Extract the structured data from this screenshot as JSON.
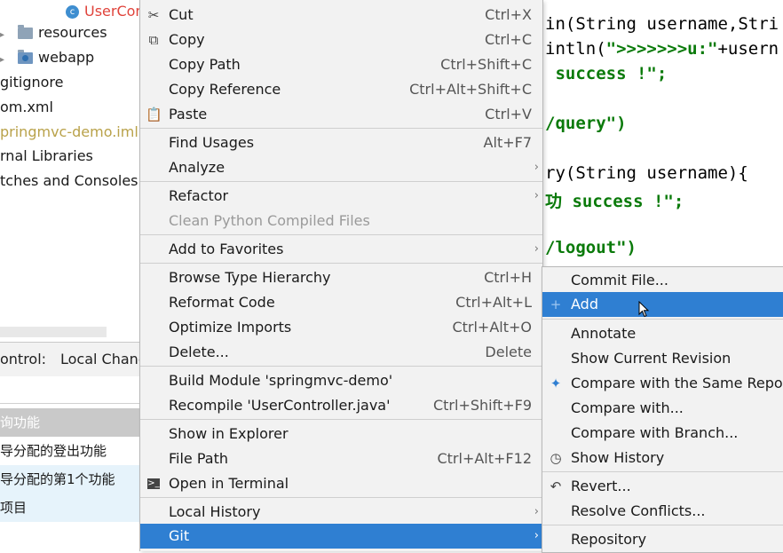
{
  "project_tree": {
    "selected_file": "UserCon",
    "items": [
      {
        "label": "resources",
        "icon": "folder-icon"
      },
      {
        "label": "webapp",
        "icon": "web-folder-icon"
      },
      {
        "label": "gitignore"
      },
      {
        "label": "om.xml"
      },
      {
        "label": "pringmvc-demo.iml"
      },
      {
        "label": "rnal Libraries"
      },
      {
        "label": "tches and Consoles"
      }
    ]
  },
  "version_control": {
    "label": "ontrol:",
    "tab": "Local Chang",
    "commits": [
      "询功能",
      "导分配的登出功能",
      "导分配的第1个功能",
      "项目"
    ]
  },
  "editor": {
    "lines": [
      {
        "text": "in(String username,Stri"
      },
      {
        "pre": "intln(",
        "str": "\">>>>>>>u:\"",
        "post": "+usern"
      },
      {
        "str": " success !\";"
      },
      {
        "ann": "/query\")"
      },
      {
        "text": "ry(String username){"
      },
      {
        "str": "功 success !\";"
      },
      {
        "ann": "/logout\")"
      }
    ]
  },
  "context_menu": {
    "items": [
      {
        "label": "Cut",
        "shortcut": "Ctrl+X",
        "icon": "scissors-icon"
      },
      {
        "label": "Copy",
        "shortcut": "Ctrl+C",
        "icon": "copy-icon"
      },
      {
        "label": "Copy Path",
        "shortcut": "Ctrl+Shift+C"
      },
      {
        "label": "Copy Reference",
        "shortcut": "Ctrl+Alt+Shift+C"
      },
      {
        "label": "Paste",
        "shortcut": "Ctrl+V",
        "icon": "clipboard-icon"
      },
      {
        "label": "Find Usages",
        "shortcut": "Alt+F7"
      },
      {
        "label": "Analyze",
        "submenu": true
      },
      {
        "label": "Refactor",
        "submenu": true
      },
      {
        "label": "Clean Python Compiled Files",
        "disabled": true
      },
      {
        "label": "Add to Favorites",
        "submenu": true
      },
      {
        "label": "Browse Type Hierarchy",
        "shortcut": "Ctrl+H"
      },
      {
        "label": "Reformat Code",
        "shortcut": "Ctrl+Alt+L"
      },
      {
        "label": "Optimize Imports",
        "shortcut": "Ctrl+Alt+O"
      },
      {
        "label": "Delete...",
        "shortcut": "Delete"
      },
      {
        "label": "Build Module 'springmvc-demo'"
      },
      {
        "label": "Recompile 'UserController.java'",
        "shortcut": "Ctrl+Shift+F9"
      },
      {
        "label": "Show in Explorer"
      },
      {
        "label": "File Path",
        "shortcut": "Ctrl+Alt+F12"
      },
      {
        "label": "Open in Terminal",
        "icon": "terminal-icon"
      },
      {
        "label": "Local History",
        "submenu": true
      },
      {
        "label": "Git",
        "submenu": true,
        "active": true
      }
    ]
  },
  "git_submenu": {
    "items": [
      {
        "label": "Commit File..."
      },
      {
        "label": "Add",
        "icon": "plus-icon",
        "active": true
      },
      {
        "label": "Annotate"
      },
      {
        "label": "Show Current Revision"
      },
      {
        "label": "Compare with the Same Repos",
        "icon": "compare-icon"
      },
      {
        "label": "Compare with..."
      },
      {
        "label": "Compare with Branch..."
      },
      {
        "label": "Show History",
        "icon": "clock-icon"
      },
      {
        "label": "Revert...",
        "icon": "undo-icon"
      },
      {
        "label": "Resolve Conflicts..."
      },
      {
        "label": "Repository"
      }
    ]
  },
  "colors": {
    "selection": "#2f7fd2",
    "menu_bg": "#f2f2f2",
    "string_green": "#0a7a0a"
  }
}
